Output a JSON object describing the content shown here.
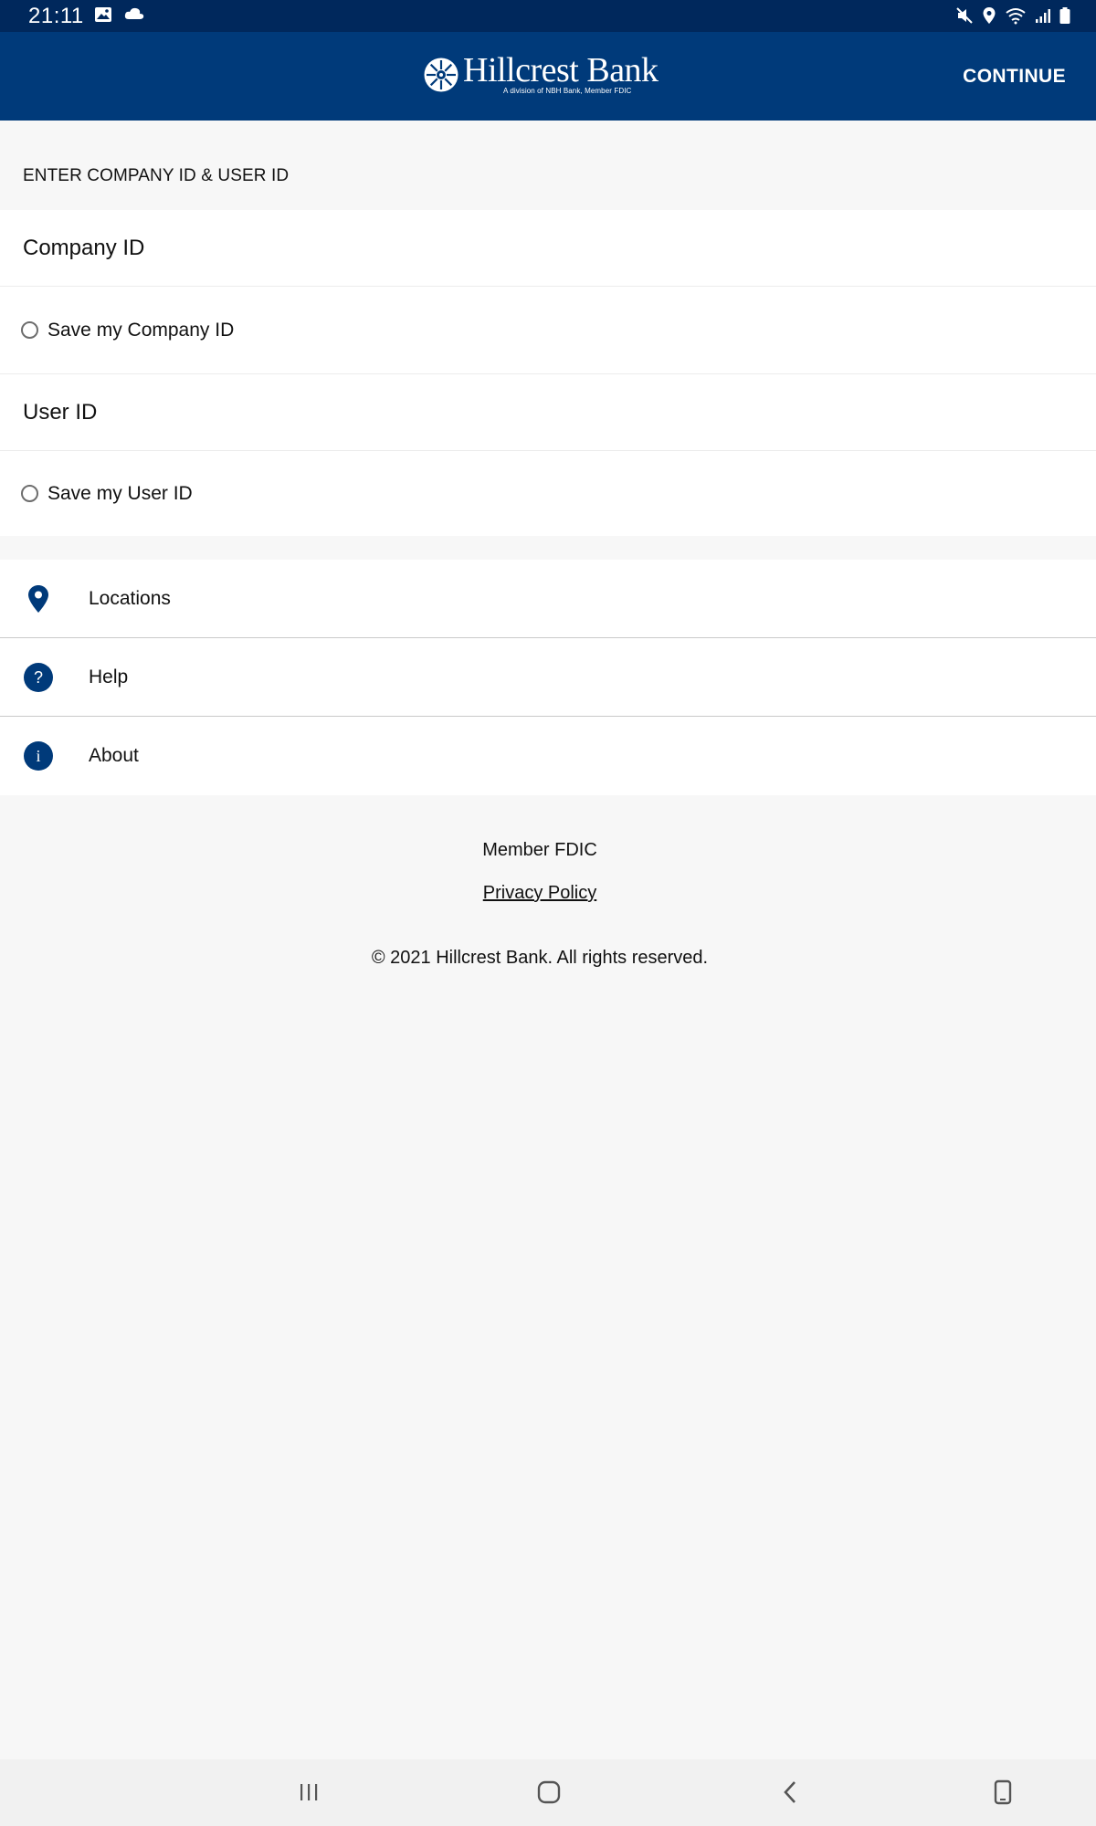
{
  "status_bar": {
    "time": "21:11"
  },
  "header": {
    "logo_name": "Hillcrest Bank",
    "logo_tagline": "A division of NBH Bank, Member FDIC",
    "continue_label": "CONTINUE"
  },
  "login": {
    "section_label": "ENTER COMPANY ID & USER ID",
    "company_id_placeholder": "Company ID",
    "save_company_id_label": "Save my Company ID",
    "user_id_placeholder": "User ID",
    "save_user_id_label": "Save my User ID"
  },
  "menu": {
    "items": [
      {
        "label": "Locations",
        "icon": "location-pin-icon"
      },
      {
        "label": "Help",
        "icon": "help-circle-icon"
      },
      {
        "label": "About",
        "icon": "info-circle-icon"
      }
    ]
  },
  "footer": {
    "member_fdic": "Member FDIC",
    "privacy_policy": "Privacy Policy",
    "copyright": "© 2021 Hillcrest Bank. All rights reserved."
  },
  "colors": {
    "brand_navy": "#003a7a",
    "status_bar": "#00285c",
    "background": "#f7f7f7"
  }
}
